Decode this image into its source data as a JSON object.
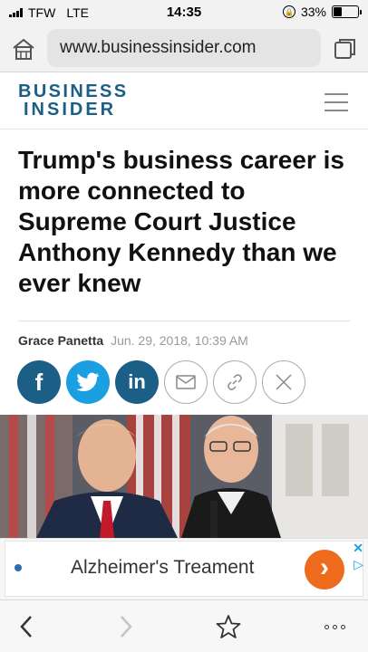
{
  "status": {
    "carrier": "TFW",
    "network": "LTE",
    "time": "14:35",
    "battery": "33%",
    "battery_level": 0.33
  },
  "browser": {
    "url": "www.businessinsider.com"
  },
  "site": {
    "logo_line1": "BUSINESS",
    "logo_line2": "INSIDER"
  },
  "article": {
    "headline": "Trump's business career is more connected to Supreme Court Justice Anthony Kennedy than we ever knew",
    "author": "Grace Panetta",
    "date": "Jun. 29, 2018, 10:39 AM"
  },
  "share": {
    "facebook": "f",
    "linkedin": "in"
  },
  "ad": {
    "text": "Alzheimer's Treament",
    "close": "✕",
    "choice": "▷",
    "arrow": "›"
  },
  "colors": {
    "brand": "#1b5e86",
    "twitter": "#1aa0e0",
    "ad_arrow": "#ee6a1c"
  }
}
